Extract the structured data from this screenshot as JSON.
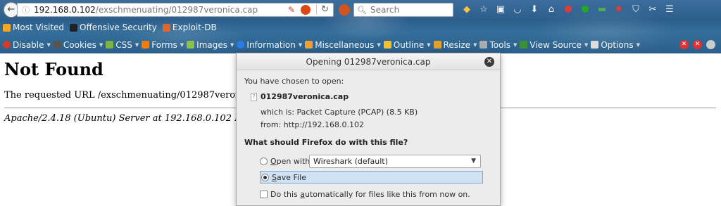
{
  "browser": {
    "url_host": "192.168.0.102",
    "url_path": "/exschmenuating/012987veronica.cap",
    "search_placeholder": "Search"
  },
  "bookmarks": [
    {
      "label": "Most Visited",
      "color": "#f5a623"
    },
    {
      "label": "Offensive Security",
      "color": "#222222"
    },
    {
      "label": "Exploit-DB",
      "color": "#e0662c"
    }
  ],
  "webdev_toolbar": [
    {
      "label": "Disable",
      "color": "#d33b2c"
    },
    {
      "label": "Cookies",
      "color": "#444444"
    },
    {
      "label": "CSS",
      "color": "#7cb342"
    },
    {
      "label": "Forms",
      "color": "#f57c00"
    },
    {
      "label": "Images",
      "color": "#8bc34a"
    },
    {
      "label": "Information",
      "color": "#2a7be4"
    },
    {
      "label": "Miscellaneous",
      "color": "#f0a030"
    },
    {
      "label": "Outline",
      "color": "#f0c030"
    },
    {
      "label": "Resize",
      "color": "#e0a030"
    },
    {
      "label": "Tools",
      "color": "#aaaaaa"
    },
    {
      "label": "View Source",
      "color": "#3a8f3a"
    },
    {
      "label": "Options",
      "color": "#dddddd"
    }
  ],
  "page": {
    "heading": "Not Found",
    "message": "The requested URL /exschmenuating/012987veronica.c",
    "address": "Apache/2.4.18 (Ubuntu) Server at 192.168.0.102 Port 8"
  },
  "dialog": {
    "title": "Opening 012987veronica.cap",
    "chosen_text": "You have chosen to open:",
    "file_name": "012987veronica.cap",
    "which_is": "which is: Packet Capture (PCAP) (8.5 KB)",
    "from": "from: http://192.168.0.102",
    "question": "What should Firefox do with this file?",
    "open_with_accel": "O",
    "open_with_rest": "pen with",
    "open_with_app": "Wireshark (default)",
    "save_accel": "S",
    "save_rest": "ave File",
    "auto_pre": "Do this ",
    "auto_accel": "a",
    "auto_rest": "utomatically for files like this from now on.",
    "selected_option": "save"
  }
}
